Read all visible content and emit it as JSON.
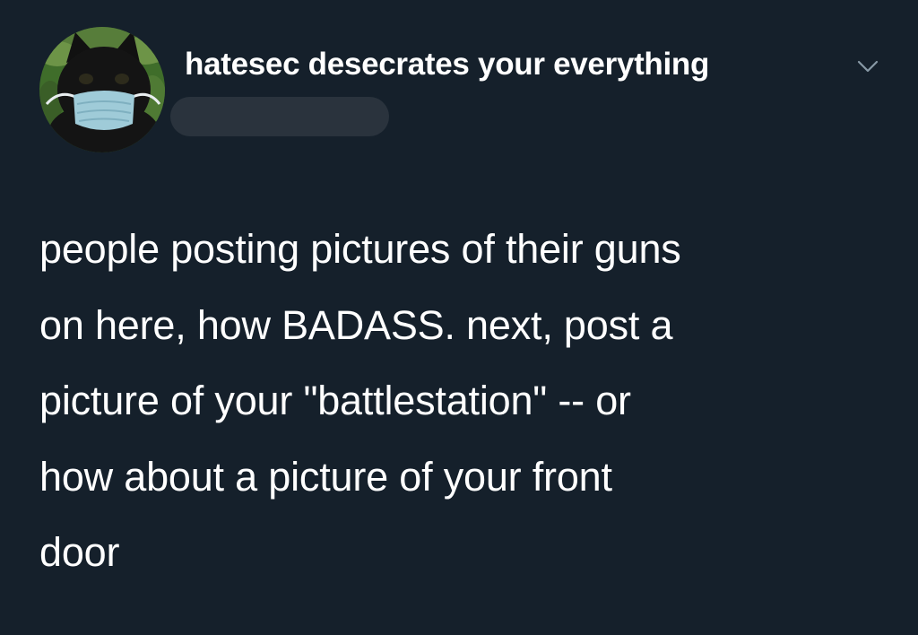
{
  "tweet": {
    "author": {
      "display_name": "hatesec desecrates your everything",
      "avatar_icon": "masked-cat-avatar"
    },
    "menu_icon": "chevron-down-icon",
    "text_lines": [
      "people posting pictures of their guns",
      "on here, how BADASS. next, post a",
      "picture of your \"battlestation\" -- or",
      "how about a picture of your front",
      "door"
    ]
  },
  "colors": {
    "background": "#15202b",
    "text": "#ffffff",
    "redaction": "#2a333d",
    "caret": "#8899a6"
  }
}
